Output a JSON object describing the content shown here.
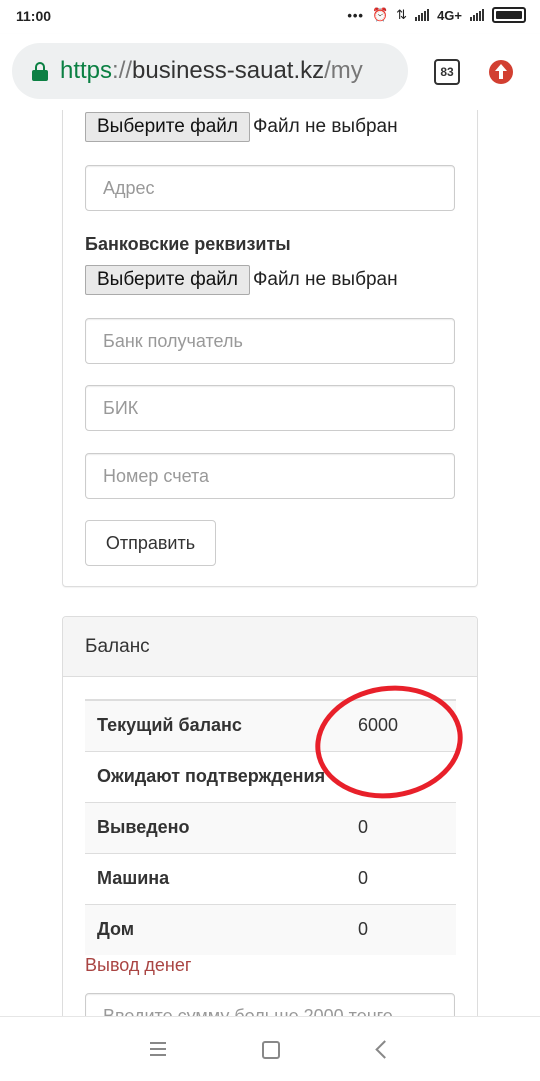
{
  "status_bar": {
    "time": "11:00",
    "network": "4G+"
  },
  "browser": {
    "url_scheme": "https",
    "url_sep": "://",
    "url_host": "business-sauat.kz",
    "url_path": "/my",
    "tab_count": "83"
  },
  "form": {
    "file1": {
      "button": "Выберите файл",
      "status": "Файл не выбран"
    },
    "address_placeholder": "Адрес",
    "bank_details_label": "Банковские реквизиты",
    "file2": {
      "button": "Выберите файл",
      "status": "Файл не выбран"
    },
    "bank_placeholder": "Банк получатель",
    "bik_placeholder": "БИК",
    "account_placeholder": "Номер счета",
    "submit_label": "Отправить"
  },
  "balance": {
    "title": "Баланс",
    "rows": [
      {
        "label": "Текущий баланс",
        "value": "6000"
      },
      {
        "label": "Ожидают подтверждения",
        "value": ""
      },
      {
        "label": "Выведено",
        "value": "0"
      },
      {
        "label": "Машина",
        "value": "0"
      },
      {
        "label": "Дом",
        "value": "0"
      }
    ],
    "withdraw_link": "Вывод денег",
    "amount_placeholder": "Введите сумму больше 2000 тенге"
  },
  "colors": {
    "annotation_circle": "#e8202a",
    "secure_green": "#0b8043",
    "link_red": "#a94442"
  }
}
